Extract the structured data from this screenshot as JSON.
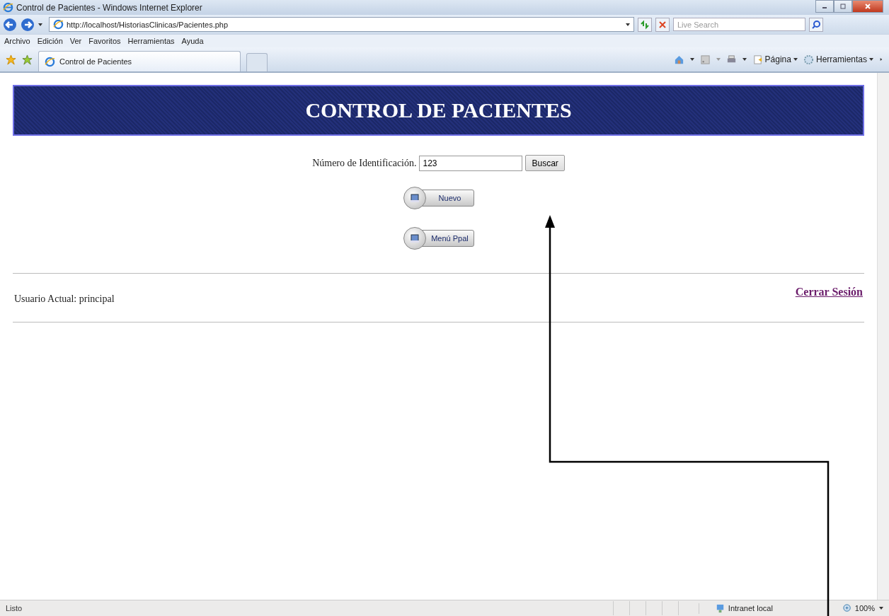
{
  "window": {
    "title": "Control de Pacientes - Windows Internet Explorer"
  },
  "address_bar": {
    "url": "http://localhost/HistoriasClinicas/Pacientes.php"
  },
  "search_box": {
    "placeholder": "Live Search"
  },
  "menu_bar": [
    "Archivo",
    "Edición",
    "Ver",
    "Favoritos",
    "Herramientas",
    "Ayuda"
  ],
  "tabs": [
    {
      "label": "Control de Pacientes",
      "selected": true
    }
  ],
  "command_bar": {
    "page_label": "Página",
    "tools_label": "Herramientas"
  },
  "page": {
    "banner": "CONTROL DE PACIENTES",
    "id_label": "Número de Identificación.",
    "id_value": "123",
    "search_button": "Buscar",
    "buttons": [
      "Nuevo",
      "Menú Ppal"
    ],
    "user_text": "Usuario Actual: principal",
    "logout_link": "Cerrar Sesión"
  },
  "status_bar": {
    "text": "Listo",
    "zone": "Intranet local",
    "zoom": "100%"
  }
}
